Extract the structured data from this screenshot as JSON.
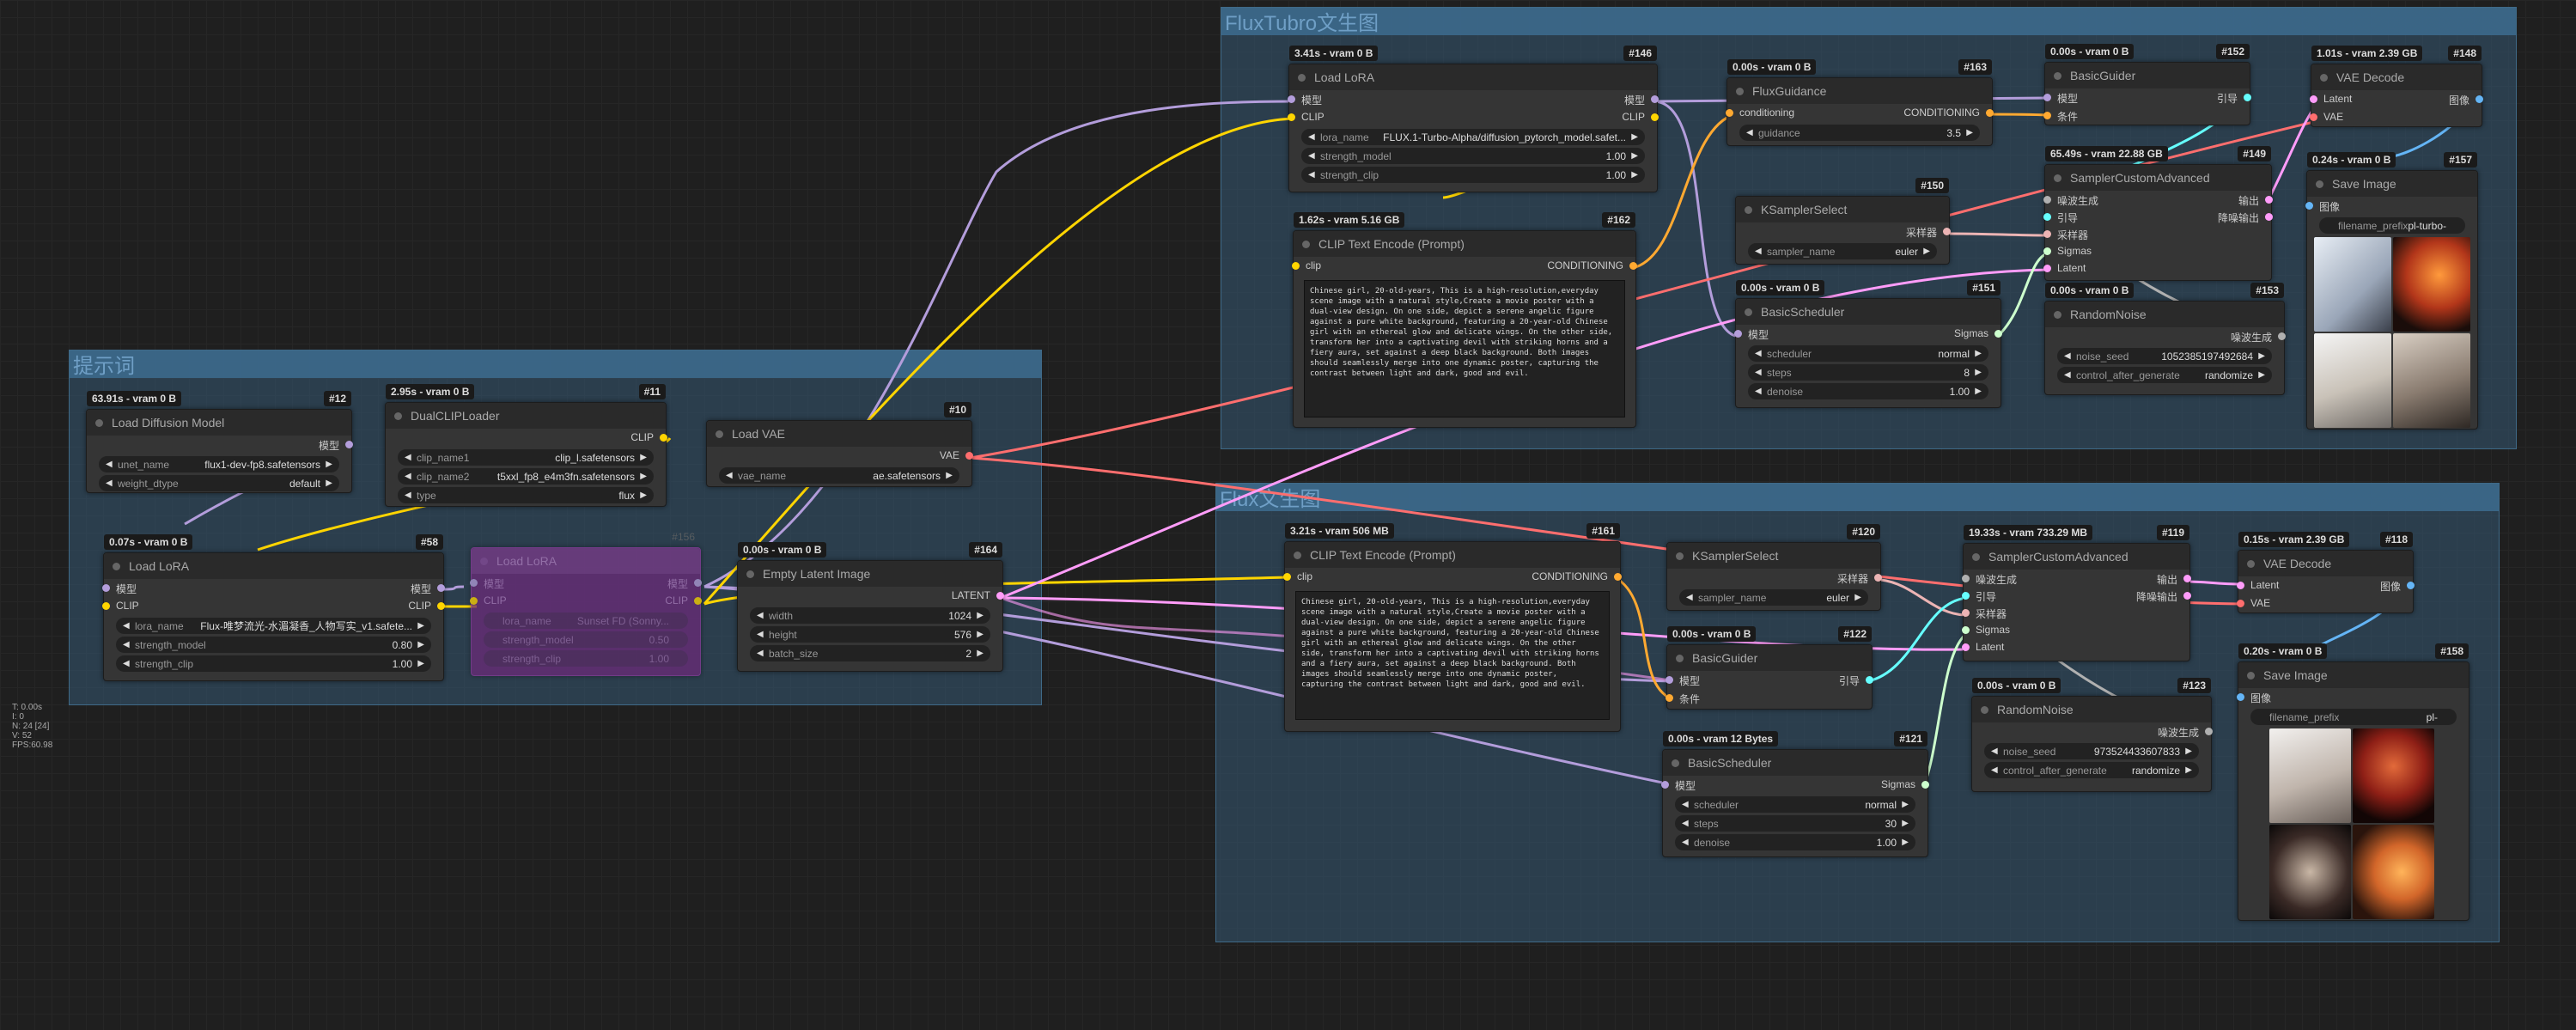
{
  "groups": {
    "left": "提示词",
    "top": "FluxTubro文生图",
    "bottom": "Flux文生图"
  },
  "nodes": {
    "n12": {
      "time": "63.91s - vram 0 B",
      "id": "#12",
      "title": "Load Diffusion Model",
      "out": "模型",
      "unet_label": "unet_name",
      "unet_value": "flux1-dev-fp8.safetensors",
      "dtype_label": "weight_dtype",
      "dtype_value": "default"
    },
    "n11": {
      "time": "2.95s - vram 0 B",
      "id": "#11",
      "title": "DualCLIPLoader",
      "out": "CLIP",
      "clip1_label": "clip_name1",
      "clip1_value": "clip_l.safetensors",
      "clip2_label": "clip_name2",
      "clip2_value": "t5xxl_fp8_e4m3fn.safetensors",
      "type_label": "type",
      "type_value": "flux"
    },
    "n10": {
      "id": "#10",
      "title": "Load VAE",
      "out": "VAE",
      "vae_label": "vae_name",
      "vae_value": "ae.safetensors"
    },
    "n58": {
      "time": "0.07s - vram 0 B",
      "id": "#58",
      "title": "Load LoRA",
      "in1": "模型",
      "in2": "CLIP",
      "out1": "模型",
      "out2": "CLIP",
      "lora_label": "lora_name",
      "lora_value": "Flux-唯梦流光-水湄凝香_人物写实_v1.safete...",
      "sm_label": "strength_model",
      "sm_value": "0.80",
      "sc_label": "strength_clip",
      "sc_value": "1.00"
    },
    "n156": {
      "id": "#156",
      "title": "Load LoRA",
      "in1": "模型",
      "in2": "CLIP",
      "out1": "模型",
      "out2": "CLIP",
      "lora_label": "lora_name",
      "lora_value": "Sunset FD (Sonny...",
      "sm_label": "strength_model",
      "sm_value": "0.50",
      "sc_label": "strength_clip",
      "sc_value": "1.00"
    },
    "n164": {
      "time": "0.00s - vram 0 B",
      "id": "#164",
      "title": "Empty Latent Image",
      "out": "LATENT",
      "width_label": "width",
      "width_value": "1024",
      "height_label": "height",
      "height_value": "576",
      "batch_label": "batch_size",
      "batch_value": "2"
    },
    "n146": {
      "time": "3.41s - vram 0 B",
      "id": "#146",
      "title": "Load LoRA",
      "in1": "模型",
      "in2": "CLIP",
      "out1": "模型",
      "out2": "CLIP",
      "lora_label": "lora_name",
      "lora_value": "FLUX.1-Turbo-Alpha/diffusion_pytorch_model.safet...",
      "sm_label": "strength_model",
      "sm_value": "1.00",
      "sc_label": "strength_clip",
      "sc_value": "1.00"
    },
    "n162": {
      "time": "1.62s - vram 5.16 GB",
      "id": "#162",
      "title": "CLIP Text Encode (Prompt)",
      "in": "clip",
      "out": "CONDITIONING",
      "text": "Chinese girl, 20-old-years, This is a high-resolution,everyday scene image with a natural style,Create a movie poster with a dual-view design. On one side, depict a serene angelic figure against a pure white background, featuring a 20-year-old Chinese girl with an ethereal glow and delicate wings. On the other side, transform her into a captivating devil with striking horns and a fiery aura, set against a deep black background. Both images should seamlessly merge into one dynamic poster, capturing the contrast between light and dark, good and evil."
    },
    "n163": {
      "time": "0.00s - vram 0 B",
      "id": "#163",
      "title": "FluxGuidance",
      "in": "conditioning",
      "out": "CONDITIONING",
      "g_label": "guidance",
      "g_value": "3.5"
    },
    "n150": {
      "id": "#150",
      "title": "KSamplerSelect",
      "out": "采样器",
      "s_label": "sampler_name",
      "s_value": "euler"
    },
    "n151": {
      "time": "0.00s - vram 0 B",
      "id": "#151",
      "title": "BasicScheduler",
      "in": "模型",
      "out": "Sigmas",
      "sch_label": "scheduler",
      "sch_value": "normal",
      "steps_label": "steps",
      "steps_value": "8",
      "den_label": "denoise",
      "den_value": "1.00"
    },
    "n152": {
      "time": "0.00s - vram 0 B",
      "id": "#152",
      "title": "BasicGuider",
      "in1": "模型",
      "in2": "条件",
      "out": "引导"
    },
    "n149": {
      "time": "65.49s - vram 22.88 GB",
      "id": "#149",
      "title": "SamplerCustomAdvanced",
      "in1": "噪波生成",
      "in2": "引导",
      "in3": "采样器",
      "in4": "Sigmas",
      "in5": "Latent",
      "out1": "输出",
      "out2": "降噪输出"
    },
    "n153": {
      "time": "0.00s - vram 0 B",
      "id": "#153",
      "title": "RandomNoise",
      "out": "噪波生成",
      "seed_label": "noise_seed",
      "seed_value": "1052385197492684",
      "ctrl_label": "control_after_generate",
      "ctrl_value": "randomize"
    },
    "n148": {
      "time": "1.01s - vram 2.39 GB",
      "id": "#148",
      "title": "VAE Decode",
      "in1": "Latent",
      "in2": "VAE",
      "out": "图像"
    },
    "n157": {
      "time": "0.24s - vram 0 B",
      "id": "#157",
      "title": "Save Image",
      "in": "图像",
      "fp_label": "filename_prefix",
      "fp_value": "pl-turbo-"
    },
    "n161": {
      "time": "3.21s - vram 506 MB",
      "id": "#161",
      "title": "CLIP Text Encode (Prompt)",
      "in": "clip",
      "out": "CONDITIONING",
      "text": "Chinese girl, 20-old-years, This is a high-resolution,everyday scene image with a natural style,Create a movie poster with a dual-view design. On one side, depict a serene angelic figure against a pure white background, featuring a 20-year-old Chinese girl with an ethereal glow and delicate wings. On the other side, transform her into a captivating devil with striking horns and a fiery aura, set against a deep black background. Both images should seamlessly merge into one dynamic poster, capturing the contrast between light and dark, good and evil."
    },
    "n120": {
      "id": "#120",
      "title": "KSamplerSelect",
      "out": "采样器",
      "s_label": "sampler_name",
      "s_value": "euler"
    },
    "n122": {
      "time": "0.00s - vram 0 B",
      "id": "#122",
      "title": "BasicGuider",
      "in1": "模型",
      "in2": "条件",
      "out": "引导"
    },
    "n121": {
      "time": "0.00s - vram 12 Bytes",
      "id": "#121",
      "title": "BasicScheduler",
      "in": "模型",
      "out": "Sigmas",
      "sch_label": "scheduler",
      "sch_value": "normal",
      "steps_label": "steps",
      "steps_value": "30",
      "den_label": "denoise",
      "den_value": "1.00"
    },
    "n119": {
      "time": "19.33s - vram 733.29 MB",
      "id": "#119",
      "title": "SamplerCustomAdvanced",
      "in1": "噪波生成",
      "in2": "引导",
      "in3": "采样器",
      "in4": "Sigmas",
      "in5": "Latent",
      "out1": "输出",
      "out2": "降噪输出"
    },
    "n123": {
      "time": "0.00s - vram 0 B",
      "id": "#123",
      "title": "RandomNoise",
      "out": "噪波生成",
      "seed_label": "noise_seed",
      "seed_value": "973524433607833",
      "ctrl_label": "control_after_generate",
      "ctrl_value": "randomize"
    },
    "n118": {
      "time": "0.15s - vram 2.39 GB",
      "id": "#118",
      "title": "VAE Decode",
      "in1": "Latent",
      "in2": "VAE",
      "out": "图像"
    },
    "n158": {
      "time": "0.20s - vram 0 B",
      "id": "#158",
      "title": "Save Image",
      "in": "图像",
      "fp_label": "filename_prefix",
      "fp_value": "pl-"
    }
  },
  "stats": {
    "t": "T: 0.00s",
    "i": "I: 0",
    "n": "N: 24 [24]",
    "v": "V: 52",
    "fps": "FPS:60.98"
  },
  "colors": {
    "model": "#b39ddb",
    "clip": "#ffd500",
    "vae": "#ff6e6e",
    "latent": "#ff9cf9",
    "conditioning": "#ffa931",
    "sigmas": "#cdffcd",
    "noise": "#b0b0b0",
    "guider": "#66ffff",
    "sampler": "#ecb4b4"
  }
}
